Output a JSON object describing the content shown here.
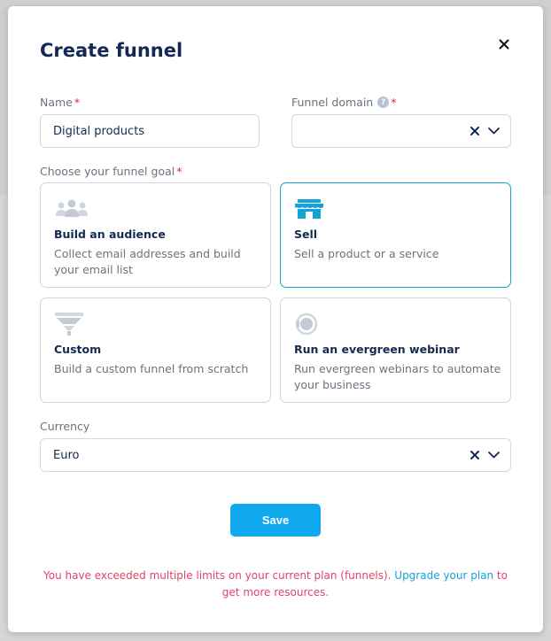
{
  "modal": {
    "title": "Create funnel"
  },
  "name_field": {
    "label": "Name",
    "required_mark": "*",
    "value": "Digital products"
  },
  "domain_field": {
    "label": "Funnel domain",
    "help_glyph": "?",
    "required_mark": "*",
    "value": ""
  },
  "goal": {
    "label": "Choose your funnel goal",
    "required_mark": "*",
    "options": [
      {
        "title": "Build an audience",
        "description": "Collect email addresses and build your email list",
        "icon": "audience-icon",
        "selected": false
      },
      {
        "title": "Sell",
        "description": "Sell a product or a service",
        "icon": "store-icon",
        "selected": true
      },
      {
        "title": "Custom",
        "description": "Build a custom funnel from scratch",
        "icon": "funnel-icon",
        "selected": false
      },
      {
        "title": "Run an evergreen webinar",
        "description": "Run evergreen webinars to automate your business",
        "icon": "webinar-icon",
        "selected": false
      }
    ]
  },
  "currency_field": {
    "label": "Currency",
    "value": "Euro"
  },
  "actions": {
    "save_label": "Save"
  },
  "warning": {
    "text_before": "You have exceeded multiple limits on your current plan (funnels). ",
    "link_text": "Upgrade your plan",
    "text_after": " to get more resources."
  },
  "colors": {
    "accent": "#10a9f0",
    "selected_border": "#12a4d9",
    "title": "#132a52",
    "error": "#e0244e"
  }
}
